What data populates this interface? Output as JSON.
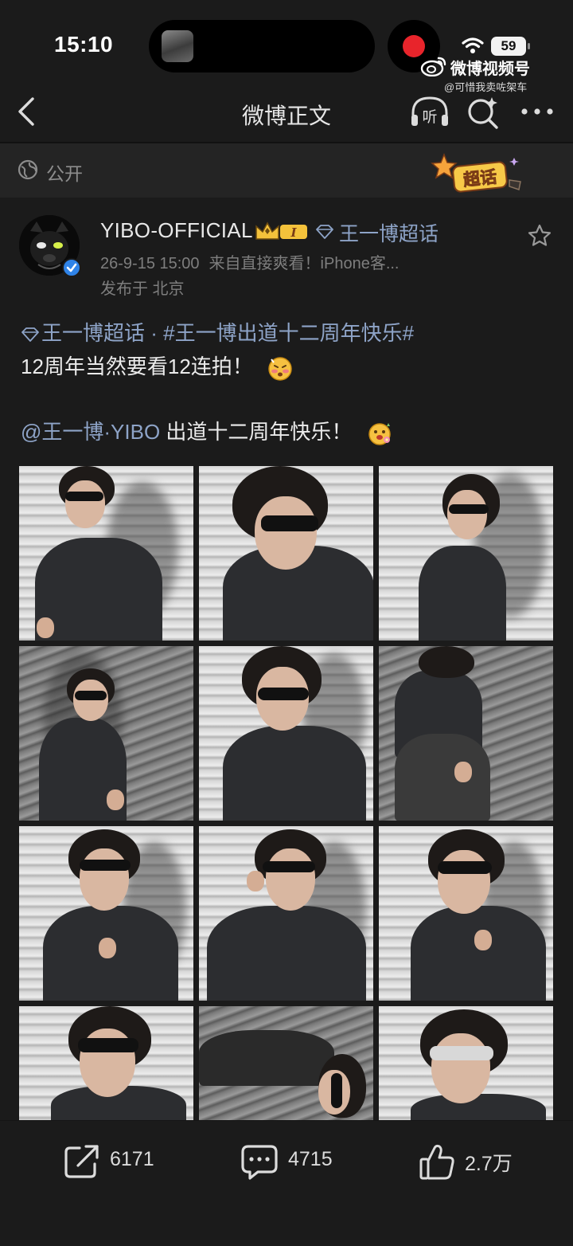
{
  "status_bar": {
    "time": "15:10",
    "battery": "59",
    "recording": true,
    "watermark_title": "微博视频号",
    "watermark_handle": "@可惜我卖咗架车"
  },
  "nav": {
    "title": "微博正文",
    "listen_label": "听"
  },
  "visibility": {
    "label": "公开",
    "badge_text": "超话"
  },
  "author": {
    "name": "YIBO-OFFICIAL",
    "level_badge": "I",
    "super_topic": "王一博超话",
    "date": "26-9-15 15:00",
    "source": "来自直接爽看！iPhone客...",
    "location": "发布于 北京"
  },
  "post": {
    "tag_topic": "王一博超话",
    "separator": "·",
    "hashtag": "#王一博出道十二周年快乐#",
    "line2": "12周年当然要看12连拍！",
    "mention": "@王一博·YIBO",
    "line3_text": "出道十二周年快乐！",
    "photo_count": 12
  },
  "actions": {
    "repost_count": "6171",
    "comment_count": "4715",
    "like_count": "2.7万"
  },
  "colors": {
    "background": "#1b1b1b",
    "link": "#8ea4c8",
    "record": "#e8242b",
    "verified": "#2f83e8"
  }
}
